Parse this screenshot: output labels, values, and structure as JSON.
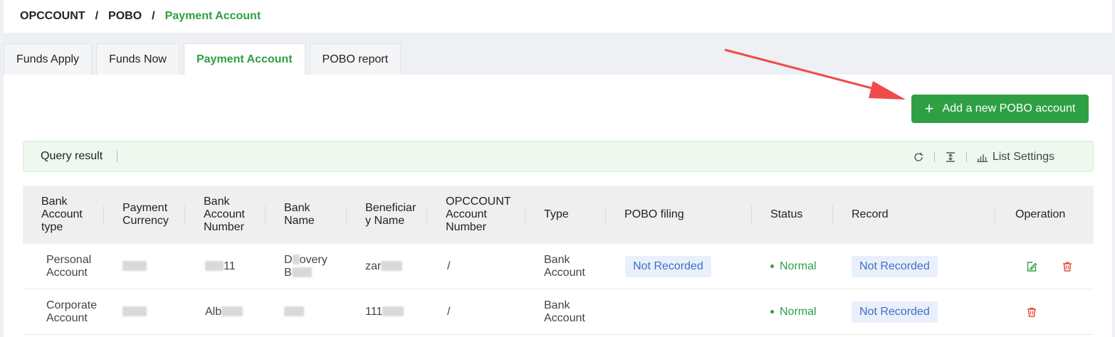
{
  "breadcrumb": {
    "items": [
      "OPCCOUNT",
      "POBO",
      "Payment Account"
    ],
    "separator": "/"
  },
  "tabs": [
    "Funds Apply",
    "Funds Now",
    "Payment Account",
    "POBO report"
  ],
  "active_tab": "Payment Account",
  "add_button": {
    "label": "Add a new POBO account",
    "icon": "plus-icon"
  },
  "query": {
    "title": "Query result",
    "list_settings": "List Settings"
  },
  "table": {
    "headers": {
      "bank_account_type": [
        "Bank",
        "Account",
        "type"
      ],
      "payment_currency": [
        "Payment",
        "Currency"
      ],
      "bank_account_number": [
        "Bank",
        "Account",
        "Number"
      ],
      "bank_name": [
        "Bank",
        "Name"
      ],
      "beneficiary_name": [
        "Beneficiar",
        "y Name"
      ],
      "opccount_account_number": [
        "OPCCOUNT",
        "Account",
        "Number"
      ],
      "type": "Type",
      "pobo_filing": "POBO filing",
      "status": "Status",
      "record": "Record",
      "operation": "Operation"
    },
    "rows": [
      {
        "account_type": [
          "Personal",
          "Account"
        ],
        "account_number_partial": "11",
        "bank_name_partial": [
          "D",
          "overy",
          "B"
        ],
        "beneficiary_partial": "zar",
        "opccount_number": "/",
        "type": [
          "Bank",
          "Account"
        ],
        "pobo_filing": "Not Recorded",
        "status": "Normal",
        "record": "Not Recorded"
      },
      {
        "account_type": [
          "Corporate",
          "Account"
        ],
        "account_number_partial": "Alb",
        "beneficiary_partial": "111",
        "opccount_number": "/",
        "type": [
          "Bank",
          "Account"
        ],
        "status": "Normal",
        "record": "Not Recorded"
      }
    ]
  },
  "colors": {
    "accent": "#2ea043",
    "badge_text": "#3a71c6",
    "badge_bg": "#e9f0fb",
    "delete": "#e64a3b",
    "arrow": "#f04b4b"
  }
}
